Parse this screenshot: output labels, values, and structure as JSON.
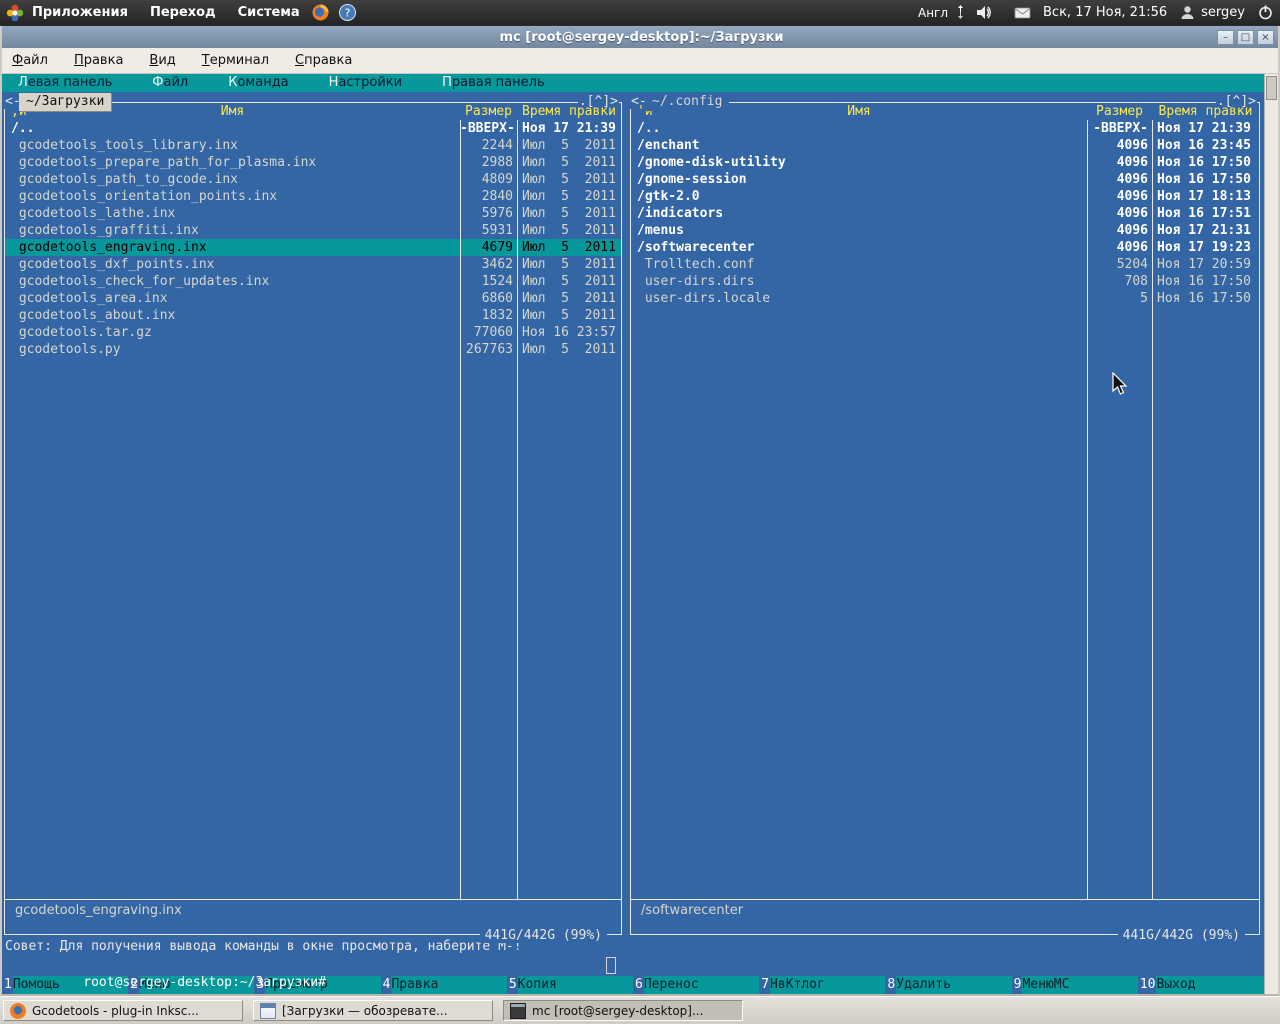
{
  "colors": {
    "terminal_bg": "#3465a4",
    "mc_cyan": "#06989a",
    "header_yellow": "#fce94f",
    "frame_white": "#e7e7e3",
    "titlebar_blue_gray": "#7e93ad"
  },
  "icons": {
    "minimize_glyph": "–",
    "maximize_glyph": "□",
    "close_glyph": "×",
    "help_glyph": "?"
  },
  "top_panel": {
    "menus": [
      {
        "label": "Приложения"
      },
      {
        "label": "Переход"
      },
      {
        "label": "Система"
      }
    ],
    "keyboard_layout": "Англ",
    "clock": "Вск, 17 Ноя, 21:56",
    "user": "sergey"
  },
  "window": {
    "title": "mc [root@sergey-desktop]:~/Загрузки",
    "menu": [
      "Файл",
      "Правка",
      "Вид",
      "Терминал",
      "Справка"
    ],
    "buttons": [
      {
        "name": "minimize",
        "glyph": "–"
      },
      {
        "name": "maximize",
        "glyph": "□"
      },
      {
        "name": "close",
        "glyph": "×"
      }
    ]
  },
  "mc": {
    "menubar": [
      "Левая панель",
      "Файл",
      "Команда",
      "Настройки",
      "Правая панель"
    ],
    "left_panel": {
      "frame_prefix": "<-",
      "path": "~/Загрузки",
      "frame_suffix": ".[^]>",
      "sort_mark": ",и",
      "columns": {
        "name": "Имя",
        "size": "Размер",
        "time": "Время правки"
      },
      "rows": [
        {
          "name": "/..",
          "size": "-ВВЕРХ-",
          "time": "Ноя 17 21:39",
          "kind": "up"
        },
        {
          "name": " gcodetools_tools_library.inx",
          "size": "2244",
          "time": "Июл  5  2011",
          "kind": "file"
        },
        {
          "name": " gcodetools_prepare_path_for_plasma.inx",
          "size": "2988",
          "time": "Июл  5  2011",
          "kind": "file"
        },
        {
          "name": " gcodetools_path_to_gcode.inx",
          "size": "4809",
          "time": "Июл  5  2011",
          "kind": "file"
        },
        {
          "name": " gcodetools_orientation_points.inx",
          "size": "2840",
          "time": "Июл  5  2011",
          "kind": "file"
        },
        {
          "name": " gcodetools_lathe.inx",
          "size": "5976",
          "time": "Июл  5  2011",
          "kind": "file"
        },
        {
          "name": " gcodetools_graffiti.inx",
          "size": "5931",
          "time": "Июл  5  2011",
          "kind": "file"
        },
        {
          "name": " gcodetools_engraving.inx",
          "size": "4679",
          "time": "Июл  5  2011",
          "kind": "file",
          "selected": true
        },
        {
          "name": " gcodetools_dxf_points.inx",
          "size": "3462",
          "time": "Июл  5  2011",
          "kind": "file"
        },
        {
          "name": " gcodetools_check_for_updates.inx",
          "size": "1524",
          "time": "Июл  5  2011",
          "kind": "file"
        },
        {
          "name": " gcodetools_area.inx",
          "size": "6860",
          "time": "Июл  5  2011",
          "kind": "file"
        },
        {
          "name": " gcodetools_about.inx",
          "size": "1832",
          "time": "Июл  5  2011",
          "kind": "file"
        },
        {
          "name": " gcodetools.tar.gz",
          "size": "77060",
          "time": "Ноя 16 23:57",
          "kind": "file"
        },
        {
          "name": " gcodetools.py",
          "size": "267763",
          "time": "Июл  5  2011",
          "kind": "file"
        }
      ],
      "status": "gcodetools_engraving.inx",
      "free_space": "441G/442G (99%)"
    },
    "right_panel": {
      "frame_prefix": "<-",
      "path": "~/.config",
      "frame_suffix": ".[^]>",
      "sort_mark": "'и",
      "columns": {
        "name": "Имя",
        "size": "Размер",
        "time": "Время правки"
      },
      "rows": [
        {
          "name": "/..",
          "size": "-ВВЕРХ-",
          "time": "Ноя 17 21:39",
          "kind": "up"
        },
        {
          "name": "/enchant",
          "size": "4096",
          "time": "Ноя 16 23:45",
          "kind": "dir"
        },
        {
          "name": "/gnome-disk-utility",
          "size": "4096",
          "time": "Ноя 16 17:50",
          "kind": "dir"
        },
        {
          "name": "/gnome-session",
          "size": "4096",
          "time": "Ноя 16 17:50",
          "kind": "dir"
        },
        {
          "name": "/gtk-2.0",
          "size": "4096",
          "time": "Ноя 17 18:13",
          "kind": "dir"
        },
        {
          "name": "/indicators",
          "size": "4096",
          "time": "Ноя 16 17:51",
          "kind": "dir"
        },
        {
          "name": "/menus",
          "size": "4096",
          "time": "Ноя 17 21:31",
          "kind": "dir"
        },
        {
          "name": "/softwarecenter",
          "size": "4096",
          "time": "Ноя 17 19:23",
          "kind": "dir"
        },
        {
          "name": " Trolltech.conf",
          "size": "5204",
          "time": "Ноя 17 20:59",
          "kind": "file"
        },
        {
          "name": " user-dirs.dirs",
          "size": "708",
          "time": "Ноя 16 17:50",
          "kind": "file"
        },
        {
          "name": " user-dirs.locale",
          "size": "5",
          "time": "Ноя 16 17:50",
          "kind": "file"
        }
      ],
      "status": "/softwarecenter",
      "free_space": "441G/442G (99%)"
    },
    "hint": "Совет: Для получения вывода команды в окне просмотра, наберите M-!",
    "prompt": "root@sergey-desktop:~/Загрузки#",
    "fkeys": [
      {
        "num": "1",
        "label": "Помощь"
      },
      {
        "num": "2",
        "label": "Меню"
      },
      {
        "num": "3",
        "label": "Просмотр"
      },
      {
        "num": "4",
        "label": "Правка"
      },
      {
        "num": "5",
        "label": "Копия"
      },
      {
        "num": "6",
        "label": "Перенос"
      },
      {
        "num": "7",
        "label": "НвКтлог"
      },
      {
        "num": "8",
        "label": "Удалить"
      },
      {
        "num": "9",
        "label": "МенюМС"
      },
      {
        "num": "10",
        "label": "Выход"
      }
    ]
  },
  "taskbar": {
    "buttons": [
      {
        "label": "Gcodetools - plug-in Inksc...",
        "icon": "firefox",
        "active": false
      },
      {
        "label": "[Загрузки — обозревате...",
        "icon": "file-manager",
        "active": false
      },
      {
        "label": "mc [root@sergey-desktop]...",
        "icon": "terminal",
        "active": true
      }
    ]
  }
}
